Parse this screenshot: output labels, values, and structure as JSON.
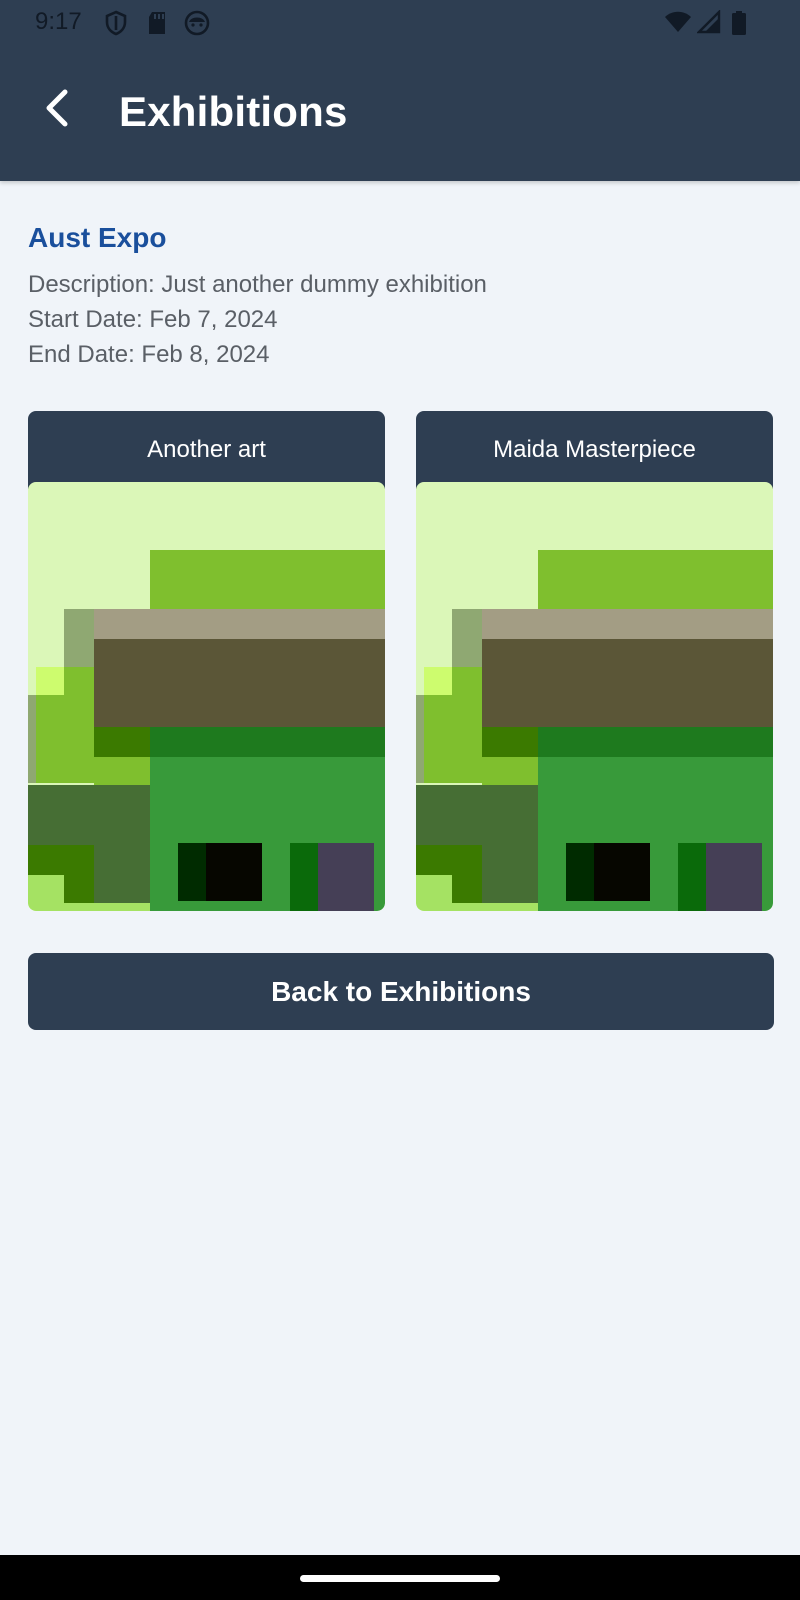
{
  "status_bar": {
    "time": "9:17",
    "left_icons": [
      "shield-icon",
      "sd-card-icon",
      "face-icon"
    ],
    "right_icons": [
      "wifi-icon",
      "signal-icon",
      "battery-icon"
    ]
  },
  "app_bar": {
    "back_icon": "arrow-back-icon",
    "title": "Exhibitions"
  },
  "exhibition": {
    "name": "Aust Expo",
    "description": "Description: Just another dummy exhibition",
    "start_date": "Start Date: Feb 7, 2024",
    "end_date": "End Date: Feb 8, 2024"
  },
  "artworks": [
    {
      "title": "Another art"
    },
    {
      "title": "Maida Masterpiece"
    }
  ],
  "back_button": {
    "label": "Back to Exhibitions"
  },
  "colors": {
    "primary": "#2e3e52",
    "accent_text": "#1a4f9c",
    "background": "#f0f4f9"
  }
}
